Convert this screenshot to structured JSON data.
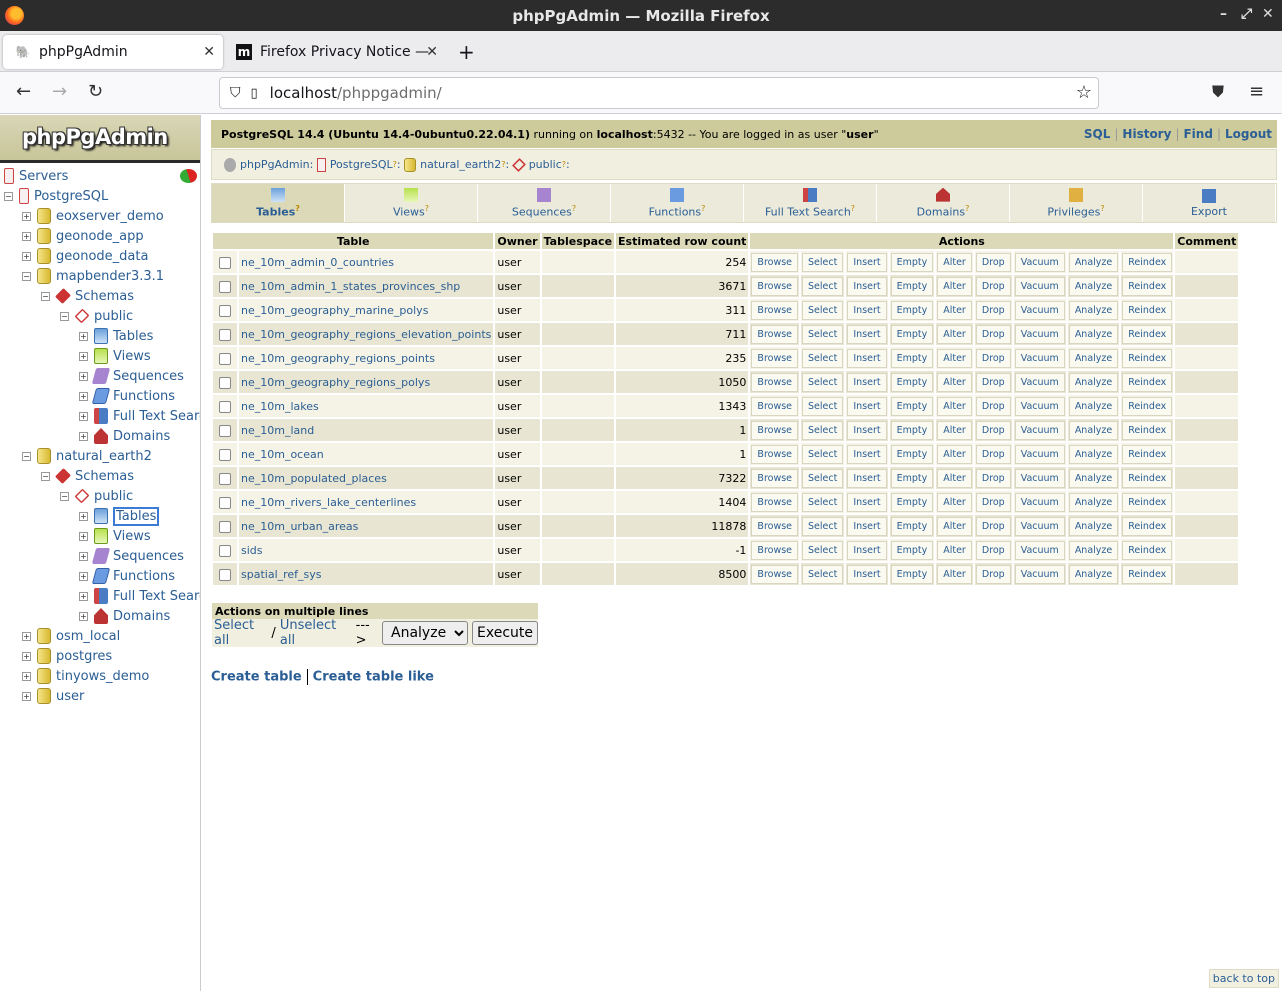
{
  "window": {
    "title": "phpPgAdmin — Mozilla Firefox"
  },
  "browser": {
    "tabs": [
      {
        "label": "phpPgAdmin",
        "active": true
      },
      {
        "label": "Firefox Privacy Notice —",
        "active": false
      }
    ],
    "new_tab": "+",
    "url_host": "localhost",
    "url_path": "/phppgadmin/"
  },
  "sidebar": {
    "logo": "phpPgAdmin",
    "tree": [
      {
        "label": "Servers",
        "icon": "servers-icon"
      },
      {
        "label": "PostgreSQL",
        "icon": "server-icon"
      },
      {
        "label": "eoxserver_demo",
        "icon": "database-icon"
      },
      {
        "label": "geonode_app",
        "icon": "database-icon"
      },
      {
        "label": "geonode_data",
        "icon": "database-icon"
      },
      {
        "label": "mapbender3.3.1",
        "icon": "database-icon"
      },
      {
        "label": "Schemas",
        "icon": "schemas-icon"
      },
      {
        "label": "public",
        "icon": "schema-icon"
      },
      {
        "label": "Tables",
        "icon": "tables-icon"
      },
      {
        "label": "Views",
        "icon": "views-icon"
      },
      {
        "label": "Sequences",
        "icon": "sequences-icon"
      },
      {
        "label": "Functions",
        "icon": "functions-icon"
      },
      {
        "label": "Full Text Search",
        "icon": "fulltext-icon"
      },
      {
        "label": "Domains",
        "icon": "domains-icon"
      },
      {
        "label": "natural_earth2",
        "icon": "database-icon"
      },
      {
        "label": "Schemas",
        "icon": "schemas-icon"
      },
      {
        "label": "public",
        "icon": "schema-icon"
      },
      {
        "label": "Tables",
        "icon": "tables-icon"
      },
      {
        "label": "Views",
        "icon": "views-icon"
      },
      {
        "label": "Sequences",
        "icon": "sequences-icon"
      },
      {
        "label": "Functions",
        "icon": "functions-icon"
      },
      {
        "label": "Full Text Search",
        "icon": "fulltext-icon"
      },
      {
        "label": "Domains",
        "icon": "domains-icon"
      },
      {
        "label": "osm_local",
        "icon": "database-icon"
      },
      {
        "label": "postgres",
        "icon": "database-icon"
      },
      {
        "label": "tinyows_demo",
        "icon": "database-icon"
      },
      {
        "label": "user",
        "icon": "database-icon"
      }
    ]
  },
  "topbar": {
    "version": "PostgreSQL 14.4 (Ubuntu 14.4-0ubuntu0.22.04.1)",
    "running_on": " running on ",
    "host": "localhost",
    "port_text": ":5432 -- You are logged in as user \"",
    "user": "user",
    "quote_end": "\"",
    "links": [
      "SQL",
      "History",
      "Find",
      "Logout"
    ]
  },
  "trail": [
    "phpPgAdmin",
    "PostgreSQL",
    "natural_earth2",
    "public"
  ],
  "tabs": [
    {
      "label": "Tables",
      "active": true
    },
    {
      "label": "Views"
    },
    {
      "label": "Sequences"
    },
    {
      "label": "Functions"
    },
    {
      "label": "Full Text Search"
    },
    {
      "label": "Domains"
    },
    {
      "label": "Privileges"
    },
    {
      "label": "Export"
    }
  ],
  "table": {
    "headers": [
      "Table",
      "Owner",
      "Tablespace",
      "Estimated row count",
      "Actions",
      "Comment"
    ],
    "actions": [
      "Browse",
      "Select",
      "Insert",
      "Empty",
      "Alter",
      "Drop",
      "Vacuum",
      "Analyze",
      "Reindex"
    ],
    "rows": [
      {
        "name": "ne_10m_admin_0_countries",
        "owner": "user",
        "tablespace": "",
        "rows": "254",
        "comment": ""
      },
      {
        "name": "ne_10m_admin_1_states_provinces_shp",
        "owner": "user",
        "tablespace": "",
        "rows": "3671",
        "comment": ""
      },
      {
        "name": "ne_10m_geography_marine_polys",
        "owner": "user",
        "tablespace": "",
        "rows": "311",
        "comment": ""
      },
      {
        "name": "ne_10m_geography_regions_elevation_points",
        "owner": "user",
        "tablespace": "",
        "rows": "711",
        "comment": ""
      },
      {
        "name": "ne_10m_geography_regions_points",
        "owner": "user",
        "tablespace": "",
        "rows": "235",
        "comment": ""
      },
      {
        "name": "ne_10m_geography_regions_polys",
        "owner": "user",
        "tablespace": "",
        "rows": "1050",
        "comment": ""
      },
      {
        "name": "ne_10m_lakes",
        "owner": "user",
        "tablespace": "",
        "rows": "1343",
        "comment": ""
      },
      {
        "name": "ne_10m_land",
        "owner": "user",
        "tablespace": "",
        "rows": "1",
        "comment": ""
      },
      {
        "name": "ne_10m_ocean",
        "owner": "user",
        "tablespace": "",
        "rows": "1",
        "comment": ""
      },
      {
        "name": "ne_10m_populated_places",
        "owner": "user",
        "tablespace": "",
        "rows": "7322",
        "comment": ""
      },
      {
        "name": "ne_10m_rivers_lake_centerlines",
        "owner": "user",
        "tablespace": "",
        "rows": "1404",
        "comment": ""
      },
      {
        "name": "ne_10m_urban_areas",
        "owner": "user",
        "tablespace": "",
        "rows": "11878",
        "comment": ""
      },
      {
        "name": "sids",
        "owner": "user",
        "tablespace": "",
        "rows": "-1",
        "comment": ""
      },
      {
        "name": "spatial_ref_sys",
        "owner": "user",
        "tablespace": "",
        "rows": "8500",
        "comment": ""
      }
    ]
  },
  "multi": {
    "header": "Actions on multiple lines",
    "select_all": "Select all",
    "slash": " / ",
    "unselect_all": "Unselect all",
    "arrow": "--->",
    "selected_action": "Analyze",
    "execute": "Execute"
  },
  "bottom_links": [
    "Create table",
    "Create table like"
  ],
  "back_to_top": "back to top"
}
